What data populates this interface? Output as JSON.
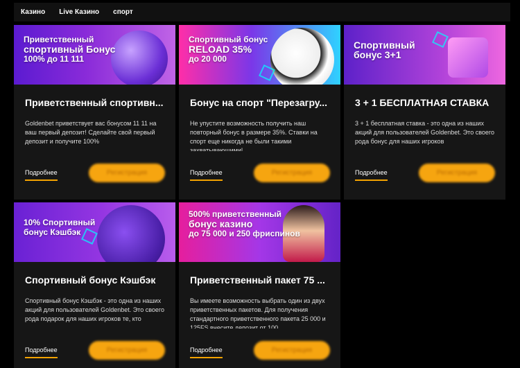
{
  "nav": {
    "items": [
      "Казино",
      "Live Казино",
      "спорт"
    ]
  },
  "cards": [
    {
      "banner": {
        "line1": "Приветственный",
        "line2": "спортивный Бонус",
        "line3": "100% до 11 111"
      },
      "title": "Приветственный спортивн...",
      "desc": "Goldenbet приветствует вас бонусом 11 11 на ваш первый депозит! Сделайте свой первый депозит и получите 100%",
      "more": "Подробнее",
      "register": "Регистрация"
    },
    {
      "banner": {
        "line1": "Спортивный бонус",
        "line2": "RELOAD 35%",
        "line3": "до 20 000"
      },
      "title": "Бонус на спорт \"Перезагру...",
      "desc": "Не упустите возможность получить наш повторный бонус в размере 35%. Ставки на спорт еще никогда не были такими захватывающими!",
      "more": "Подробнее",
      "register": "Регистрация"
    },
    {
      "banner": {
        "line1": "Спортивный",
        "line2": "бонус 3+1",
        "line3": ""
      },
      "title": "3 + 1 БЕСПЛАТНАЯ СТАВКА",
      "desc": "3 + 1 бесплатная ставка - это одна из наших акций для пользователей Goldenbet. Это своего рода бонус для наших игроков",
      "more": "Подробнее",
      "register": "Регистрация"
    },
    {
      "banner": {
        "line1": "10% Спортивный",
        "line2": "бонус Кэшбэк",
        "line3": ""
      },
      "title": "Спортивный бонус Кэшбэк",
      "desc": "Спортивный бонус Кэшбэк - это одна из наших акций для пользователей Goldenbet. Это своего рода подарок для наших игроков те, кто",
      "more": "Подробнее",
      "register": "Регистрация"
    },
    {
      "banner": {
        "line1": "500% приветственный",
        "line2": "бонус казино",
        "line3": "до 75 000 и 250 фриспинов"
      },
      "title": "Приветственный пакет 75 ...",
      "desc": "Вы имеете возможность выбрать один из двух приветственных пакетов. Для получения стандартного приветственного пакета 25 000 и 125FS внесите депозит от 100",
      "more": "Подробнее",
      "register": "Регистрация"
    }
  ],
  "colors": {
    "accent": "#f6a510",
    "card_bg": "#161616",
    "page_bg": "#000000"
  }
}
